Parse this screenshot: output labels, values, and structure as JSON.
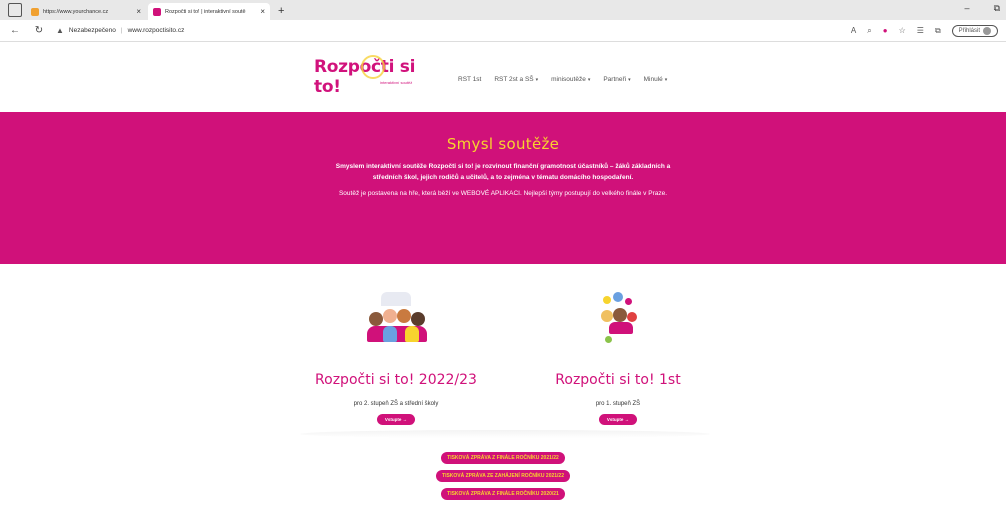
{
  "browser": {
    "tabs": [
      {
        "title": "https://www.yourchance.cz",
        "fav_color": "#f0a030"
      },
      {
        "title": "Rozpočti si to! | interaktivní soutě",
        "fav_color": "#d0117a"
      }
    ],
    "new_tab": "+",
    "close": "×",
    "url_warning": "Nezabezpečeno",
    "url": "www.rozpoctisito.cz",
    "signin_label": "Přihlásit",
    "window_min": "–",
    "window_restore": "⧉"
  },
  "site": {
    "logo_text": "Rozpočti si to!",
    "logo_sub": "interaktivní soutěž",
    "nav": [
      {
        "label": "RST 1st",
        "dropdown": false
      },
      {
        "label": "RST 2st a SŠ",
        "dropdown": true
      },
      {
        "label": "minisoutěže",
        "dropdown": true
      },
      {
        "label": "Partneři",
        "dropdown": true
      },
      {
        "label": "Minulé",
        "dropdown": true
      }
    ],
    "caret": "▾"
  },
  "hero": {
    "title": "Smysl soutěže",
    "bold_line1": "Smyslem interaktivní soutěže Rozpočti si to! je rozvinout finanční gramotnost účastníků – žáků základních a",
    "bold_line2": "středních škol, jejich rodičů a učitelů, a to zejména v tématu domácího hospodaření.",
    "normal": "Soutěž je postavena na hře, která běží ve WEBOVÉ APLIKACI. Nejlepší týmy postupují do velkého finále v Praze."
  },
  "cards": [
    {
      "title": "Rozpočti si to! 2022/23",
      "desc": "pro 2. stupeň ZŠ a střední školy",
      "button": "Vstupte →"
    },
    {
      "title": "Rozpočti si to! 1st",
      "desc": "pro 1. stupeň ZŠ",
      "button": "Vstupte →"
    }
  ],
  "links": [
    "TISKOVÁ ZPRÁVA Z FINÁLE ROČNÍKU 2021/22",
    "TISKOVÁ ZPRÁVA ZE ZAHÁJENÍ ROČNÍKU 2021/22",
    "TISKOVÁ ZPRÁVA Z FINÁLE ROČNÍKU 2020/21"
  ],
  "colors": {
    "brand": "#d0117a",
    "accent": "#f7d42e"
  }
}
